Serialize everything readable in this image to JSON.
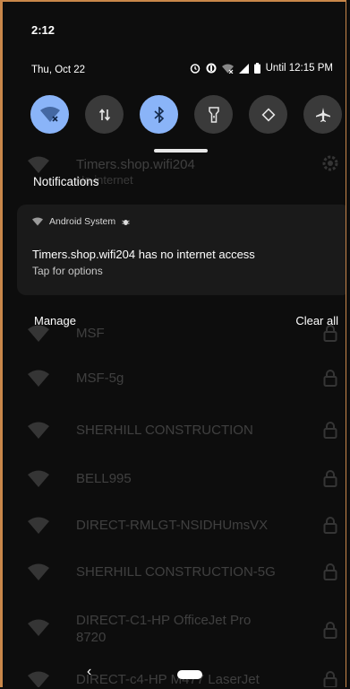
{
  "status_bar": {
    "time": "2:12",
    "date": "Thu, Oct 22",
    "battery_text": "Until 12:15 PM"
  },
  "quick_tiles": [
    {
      "name": "wifi-off-icon",
      "active": true
    },
    {
      "name": "mobile-data-icon",
      "active": false
    },
    {
      "name": "bluetooth-icon",
      "active": true
    },
    {
      "name": "flashlight-icon",
      "active": false
    },
    {
      "name": "auto-rotate-icon",
      "active": false
    },
    {
      "name": "airplane-icon",
      "active": false
    }
  ],
  "notifications": {
    "header": "Notifications",
    "card": {
      "app": "Android System",
      "title": "Timers.shop.wifi204 has no internet access",
      "subtitle": "Tap for options"
    },
    "manage": "Manage",
    "clear_all": "Clear all"
  },
  "wifi_list": {
    "connected": {
      "name": "Timers.shop.wifi204",
      "status": "No internet"
    },
    "networks": [
      "MSF",
      "MSF-5g",
      "SHERHILL CONSTRUCTION",
      "BELL995",
      "DIRECT-RMLGT-NSIDHUmsVX",
      "SHERHILL CONSTRUCTION-5G",
      "DIRECT-C1-HP OfficeJet Pro 8720",
      "DIRECT-c4-HP M477 LaserJet"
    ]
  },
  "nav": {
    "back": "‹"
  }
}
